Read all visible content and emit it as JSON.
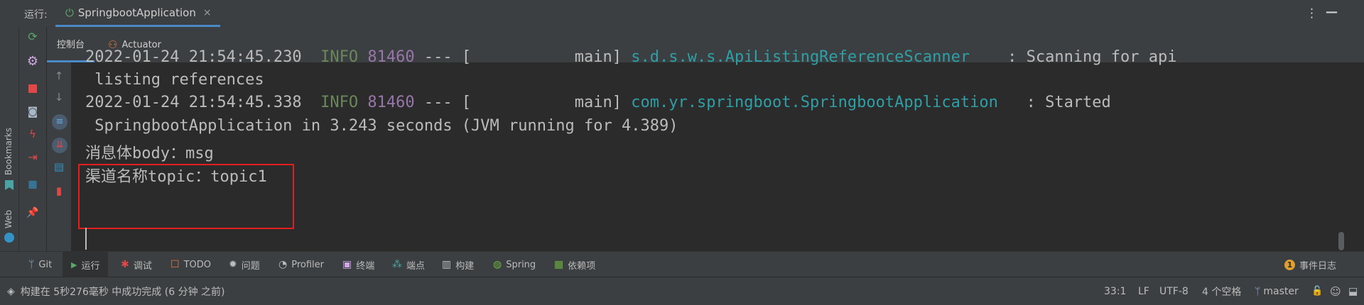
{
  "topbar": {
    "run_label": "运行:",
    "run_tab_title": "SpringbootApplication",
    "close_glyph": "×",
    "more_glyph": "⋮",
    "minimize_glyph": "—"
  },
  "left_strip": {
    "bookmarks_label": "Bookmarks",
    "web_label": "Web"
  },
  "subtabs": {
    "console_label": "控制台",
    "actuator_label": "Actuator"
  },
  "console": {
    "lines": [
      {
        "date": "2022-01-24 21:54:45.230",
        "level": "INFO",
        "pid": "81460",
        "sep": "---",
        "thread": "[           main]",
        "logger": "s.d.s.w.s.ApiListingReferenceScanner",
        "msg": "   : Scanning for api"
      },
      {
        "date": "2022-01-24 21:54:45.338",
        "level": "INFO",
        "pid": "81460",
        "sep": "---",
        "thread": "[           main]",
        "logger": "com.yr.springboot.SpringbootApplication",
        "msg": "  : Started"
      }
    ],
    "wrap1": " listing references",
    "wrap2": " SpringbootApplication in 3.243 seconds (JVM running for 4.389)",
    "output1": "消息体body：msg",
    "output2": "渠道名称topic：topic1"
  },
  "tool_windows": [
    {
      "label": "Git",
      "icon": "git-icon",
      "glyph": "ᛘ"
    },
    {
      "label": "运行",
      "icon": "run-icon",
      "glyph": "▶"
    },
    {
      "label": "调试",
      "icon": "debug-icon",
      "glyph": "✱"
    },
    {
      "label": "TODO",
      "icon": "todo-icon",
      "glyph": "☐"
    },
    {
      "label": "问题",
      "icon": "problems-icon",
      "glyph": "✹"
    },
    {
      "label": "Profiler",
      "icon": "profiler-icon",
      "glyph": "◔"
    },
    {
      "label": "终端",
      "icon": "terminal-icon",
      "glyph": "▣"
    },
    {
      "label": "端点",
      "icon": "endpoints-icon",
      "glyph": "⁂"
    },
    {
      "label": "构建",
      "icon": "build-icon",
      "glyph": "▥"
    },
    {
      "label": "Spring",
      "icon": "spring-icon",
      "glyph": "◍"
    },
    {
      "label": "依赖项",
      "icon": "dependencies-icon",
      "glyph": "▦"
    }
  ],
  "event_log": {
    "count": "1",
    "label": "事件日志"
  },
  "status": {
    "message": "构建在 5秒276毫秒 中成功完成 (6 分钟 之前)",
    "position": "33:1",
    "line_sep": "LF",
    "encoding": "UTF-8",
    "indent": "4 个空格",
    "branch": "master"
  },
  "colors": {
    "accent": "#4a88c7",
    "info": "#6a8759",
    "pid": "#9876aa",
    "logger": "#2f9fa6",
    "highlight": "#e51d1d"
  }
}
